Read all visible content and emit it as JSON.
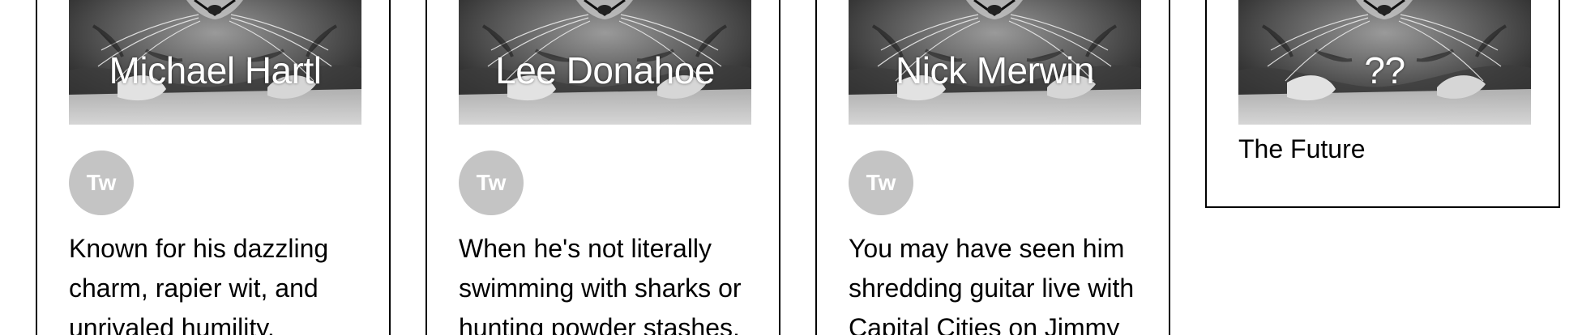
{
  "team": [
    {
      "name": "Michael Hartl",
      "photo_icon": "cat-photo",
      "social_badge": "Tw",
      "social_icon": "twitter-icon",
      "bio": "Known for his dazzling charm, rapier wit, and unrivaled humility,"
    },
    {
      "name": "Lee Donahoe",
      "photo_icon": "cat-photo",
      "social_badge": "Tw",
      "social_icon": "twitter-icon",
      "bio": "When he's not literally swimming with sharks or hunting powder stashes,"
    },
    {
      "name": "Nick Merwin",
      "photo_icon": "cat-photo",
      "social_badge": "Tw",
      "social_icon": "twitter-icon",
      "bio": "You may have seen him shredding guitar live with Capital Cities on Jimmy"
    },
    {
      "name": "??",
      "photo_icon": "cat-photo",
      "subtitle": "The Future"
    }
  ],
  "colors": {
    "border": "#000000",
    "badge_bg": "#c4c4c4",
    "badge_text": "#ffffff",
    "name_text": "#ffffff",
    "body_text": "#000000"
  }
}
